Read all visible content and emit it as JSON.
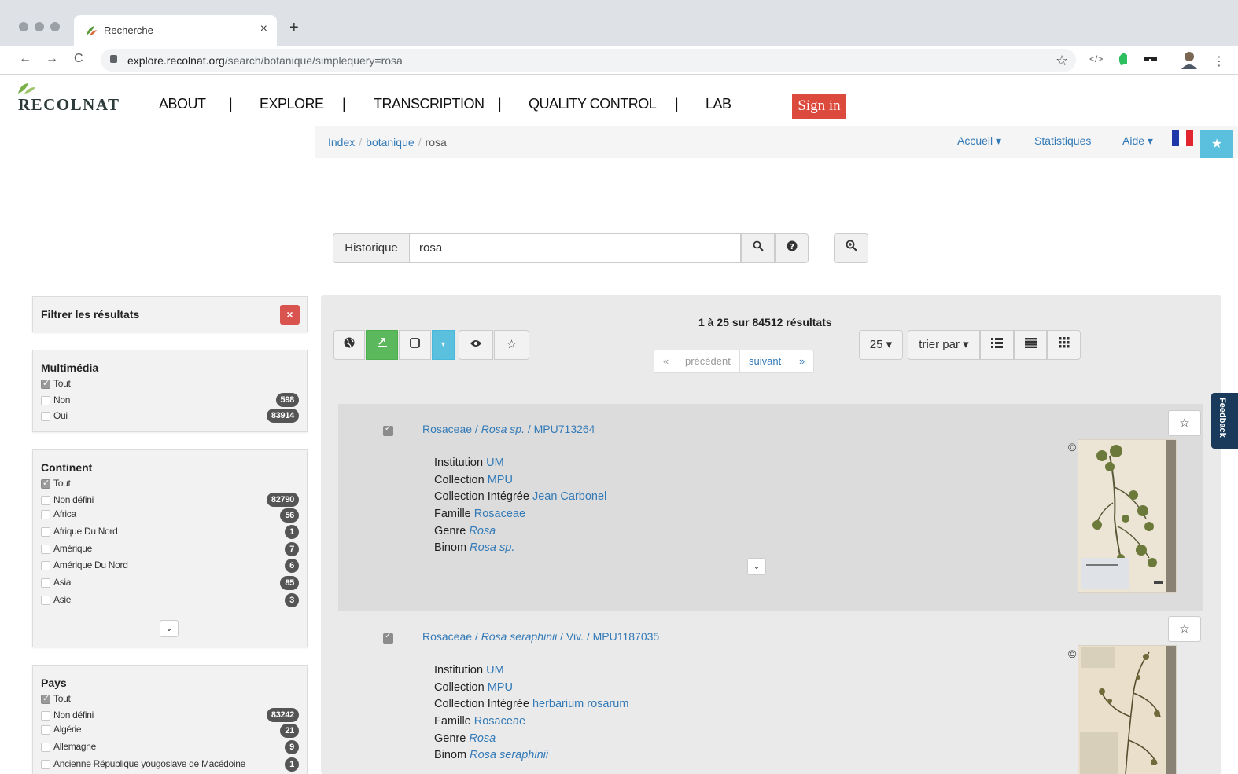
{
  "browser": {
    "tab_title": "Recherche",
    "tab_close": "×",
    "new_tab": "+",
    "url_host": "explore.recolnat.org",
    "url_path": "/search/botanique/simplequery=rosa",
    "nav": {
      "back": "←",
      "forward": "→",
      "reload": "C"
    },
    "ext": {
      "star": "☆",
      "code": "</>",
      "extra": "⋮"
    }
  },
  "site": {
    "logo_text": "RECOLNAT",
    "nav": [
      "ABOUT",
      "EXPLORE",
      "TRANSCRIPTION",
      "QUALITY CONTROL",
      "LAB"
    ],
    "separator": "|",
    "signin": "Sign in",
    "breadcrumb": {
      "index": "Index",
      "botanique": "botanique",
      "rosa": "rosa",
      "divider": "/"
    },
    "topright": {
      "accueil": "Accueil ▾",
      "statistiques": "Statistiques",
      "aide": "Aide ▾",
      "star": "★"
    },
    "colors": {
      "accent": "#337ab7",
      "signin": "#dc4a3d",
      "info": "#5bc0de",
      "success": "#5cb85c",
      "danger": "#d9534f"
    }
  },
  "search": {
    "historique": "Historique",
    "query": "rosa",
    "search_icon": "search-icon",
    "help_icon": "question-circle-icon",
    "zoom_icon": "zoom-in-icon"
  },
  "filters": {
    "title": "Filtrer les résultats",
    "close": "×",
    "multimedia": {
      "title": "Multimédia",
      "items": [
        {
          "label": "Tout",
          "checked": true,
          "count": ""
        },
        {
          "label": "Non",
          "checked": false,
          "count": "598"
        },
        {
          "label": "Oui",
          "checked": false,
          "count": "83914"
        }
      ]
    },
    "continent": {
      "title": "Continent",
      "items": [
        {
          "label": "Tout",
          "checked": true,
          "count": ""
        },
        {
          "label": "Non défini",
          "checked": false,
          "count": "82790"
        },
        {
          "label": "Africa",
          "checked": false,
          "count": "56"
        },
        {
          "label": "Afrique Du Nord",
          "checked": false,
          "count": "1"
        },
        {
          "label": "Amérique",
          "checked": false,
          "count": "7"
        },
        {
          "label": "Amérique Du Nord",
          "checked": false,
          "count": "6"
        },
        {
          "label": "Asia",
          "checked": false,
          "count": "85"
        },
        {
          "label": "Asie",
          "checked": false,
          "count": "3"
        }
      ]
    },
    "pays": {
      "title": "Pays",
      "items": [
        {
          "label": "Tout",
          "checked": true,
          "count": ""
        },
        {
          "label": "Non défini",
          "checked": false,
          "count": "83242"
        },
        {
          "label": "Algérie",
          "checked": false,
          "count": "21"
        },
        {
          "label": "Allemagne",
          "checked": false,
          "count": "9"
        },
        {
          "label": "Ancienne République yougoslave de Macédoine",
          "checked": false,
          "count": "1"
        }
      ]
    },
    "more": "⌄"
  },
  "results": {
    "counter": "1 à 25 sur 84512 résultats",
    "pager": {
      "first": "«",
      "prev": "précédent",
      "next": "suivant",
      "last": "»"
    },
    "page_size": "25 ▾",
    "sort": "trier par ▾",
    "records": [
      {
        "title_family": "Rosaceae",
        "title_species": "Rosa sp.",
        "title_rest": "/ MPU713264",
        "rows": [
          {
            "label": "Institution",
            "value": "UM",
            "italic": false
          },
          {
            "label": "Collection",
            "value": "MPU",
            "italic": false
          },
          {
            "label": "Collection Intégrée",
            "value": "Jean Carbonel",
            "italic": false
          },
          {
            "label": "Famille",
            "value": "Rosaceae",
            "italic": false
          },
          {
            "label": "Genre",
            "value": "Rosa",
            "italic": true
          },
          {
            "label": "Binom",
            "value": "Rosa sp.",
            "italic": true
          }
        ]
      },
      {
        "title_family": "Rosaceae",
        "title_species": "Rosa seraphinii",
        "title_rest": "/ Viv. / MPU1187035",
        "rows": [
          {
            "label": "Institution",
            "value": "UM",
            "italic": false
          },
          {
            "label": "Collection",
            "value": "MPU",
            "italic": false
          },
          {
            "label": "Collection Intégrée",
            "value": "herbarium rosarum",
            "italic": false
          },
          {
            "label": "Famille",
            "value": "Rosaceae",
            "italic": false
          },
          {
            "label": "Genre",
            "value": "Rosa",
            "italic": true
          },
          {
            "label": "Binom",
            "value": "Rosa seraphinii",
            "italic": true
          }
        ]
      }
    ],
    "copyright": "©",
    "expand": "⌄",
    "star": "☆"
  },
  "feedback": "Feedback"
}
